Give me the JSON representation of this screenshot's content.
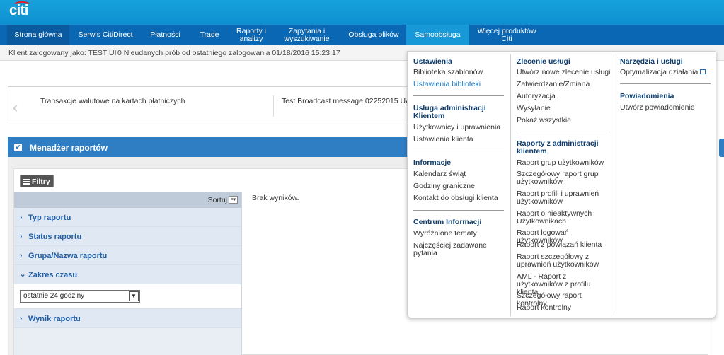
{
  "brand": {
    "logo_text": "citi",
    "accent": "#0a67b3",
    "arc_color": "#e31b23"
  },
  "nav": {
    "items": [
      {
        "label": "Strona główna"
      },
      {
        "label": "Serwis CitiDirect"
      },
      {
        "label": "Płatności"
      },
      {
        "label": "Trade"
      },
      {
        "label": "Raporty i\nanalizy"
      },
      {
        "label": "Zapytania i\nwyszukiwanie"
      },
      {
        "label": "Obsługa plików"
      },
      {
        "label": "Samoobsługa"
      },
      {
        "label": "Więcej produktów\nCiti"
      }
    ]
  },
  "userline": {
    "logged_as": "Klient zalogowany jako:",
    "user": "TEST UI",
    "failed_logins": "0 Nieudanych prób od ostatniego zalogowania 01/18/2016 15:23:17"
  },
  "carousel": {
    "message_1": "Transakcje walutowe na kartach płatniczych",
    "message_2": "Test Broadcast message 02252015 UAT",
    "prev_icon": "chevron-left-icon"
  },
  "report_manager": {
    "title": "Menadżer raportów",
    "filters_button": "Filtry",
    "sort_label": "Sortuj",
    "facets": [
      {
        "label": "Typ raportu",
        "expanded": false
      },
      {
        "label": "Status raportu",
        "expanded": false
      },
      {
        "label": "Grupa/Nazwa raportu",
        "expanded": false
      },
      {
        "label": "Zakres czasu",
        "expanded": true
      },
      {
        "label": "Wynik raportu",
        "expanded": false
      }
    ],
    "time_range_value": "ostatnie 24 godziny",
    "no_results": "Brak wyników."
  },
  "mega_menu": {
    "col1": {
      "group1": {
        "title": "Ustawienia",
        "items": [
          "Biblioteka szablonów",
          "Ustawienia biblioteki"
        ]
      },
      "group2": {
        "title": "Usługa administracji Klientem",
        "items": [
          "Użytkownicy i uprawnienia",
          "Ustawienia klienta"
        ]
      },
      "group3": {
        "title": "Informacje",
        "items": [
          "Kalendarz świąt",
          "Godziny graniczne",
          "Kontakt do obsługi klienta"
        ]
      },
      "group4": {
        "title": "Centrum Informacji",
        "items": [
          "Wyróżnione tematy",
          "Najczęściej zadawane pytania"
        ]
      }
    },
    "col2": {
      "group1": {
        "title": "Zlecenie usługi",
        "items": [
          "Utwórz nowe zlecenie usługi",
          "Zatwierdzanie/Zmiana",
          "Autoryzacja",
          "Wysyłanie",
          "Pokaż wszystkie"
        ]
      },
      "group2": {
        "title": "Raporty z administracji klientem",
        "items": [
          "Raport grup użytkowników",
          "Szczegółowy raport grup użytkowników",
          "Raport profili i uprawnień użytkowników",
          "Raport o nieaktywnych Użytkownikach",
          "Raport logowań użytkowników",
          "Raport z powiązań klienta",
          "Raport szczegółowy z uprawnień użytkowników",
          "AML - Raport z użytkowników z profilu klienta",
          "Szczegółowy raport kontrolny",
          "Raport kontrolny"
        ]
      }
    },
    "col3": {
      "group1": {
        "title": "Narzędzia i usługi",
        "items": [
          "Optymalizacja działania"
        ]
      },
      "group2": {
        "title": "Powiadomienia",
        "items": [
          "Utwórz powiadomienie"
        ]
      }
    }
  }
}
